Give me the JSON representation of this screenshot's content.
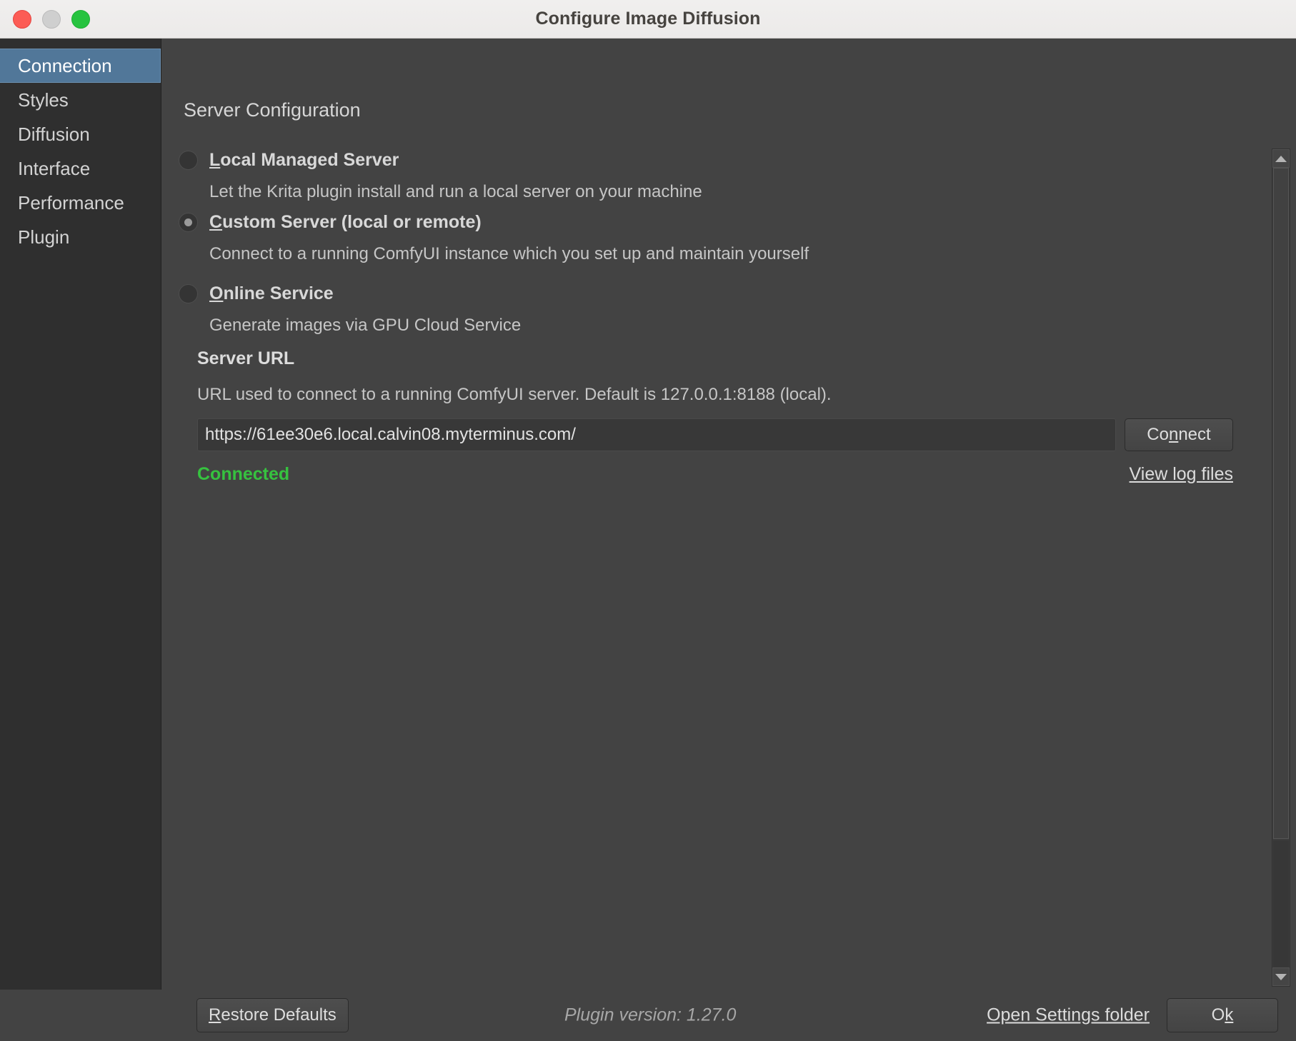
{
  "window": {
    "title": "Configure Image Diffusion",
    "traffic_lights": [
      "close-button",
      "minimize-button",
      "maximize-button"
    ]
  },
  "sidebar": {
    "items": [
      {
        "label": "Connection",
        "selected": true
      },
      {
        "label": "Styles",
        "selected": false
      },
      {
        "label": "Diffusion",
        "selected": false
      },
      {
        "label": "Interface",
        "selected": false
      },
      {
        "label": "Performance",
        "selected": false
      },
      {
        "label": "Plugin",
        "selected": false
      }
    ]
  },
  "main": {
    "section_title": "Server Configuration",
    "options": [
      {
        "label_mnemonic": "L",
        "label_rest": "ocal Managed Server",
        "description": "Let the Krita plugin install and run a local server on your machine",
        "selected": false
      },
      {
        "label_mnemonic": "C",
        "label_rest": "ustom Server (local or remote)",
        "description": "Connect to a running ComfyUI instance which you set up and maintain yourself",
        "selected": true
      },
      {
        "label_mnemonic": "O",
        "label_rest": "nline Service",
        "description": "Generate images via GPU Cloud Service",
        "selected": false
      }
    ],
    "server_url": {
      "heading": "Server URL",
      "help": "URL used to connect to a running ComfyUI server. Default is 127.0.0.1:8188 (local).",
      "value": "https://61ee30e6.local.calvin08.myterminus.com/",
      "placeholder": "",
      "connect_button": {
        "prefix": "Co",
        "mnemonic": "n",
        "suffix": "nect"
      },
      "status": "Connected",
      "status_color": "#36c23f",
      "log_link": "View log files"
    }
  },
  "footer": {
    "restore_defaults": {
      "prefix": "",
      "mnemonic": "R",
      "suffix": "estore Defaults"
    },
    "plugin_version": "Plugin version: 1.27.0",
    "open_settings": "Open Settings folder",
    "ok_button": {
      "prefix": "O",
      "mnemonic": "k",
      "suffix": ""
    }
  },
  "scrollbar": {
    "up_icon": "chevron-up-icon",
    "down_icon": "chevron-down-icon"
  }
}
